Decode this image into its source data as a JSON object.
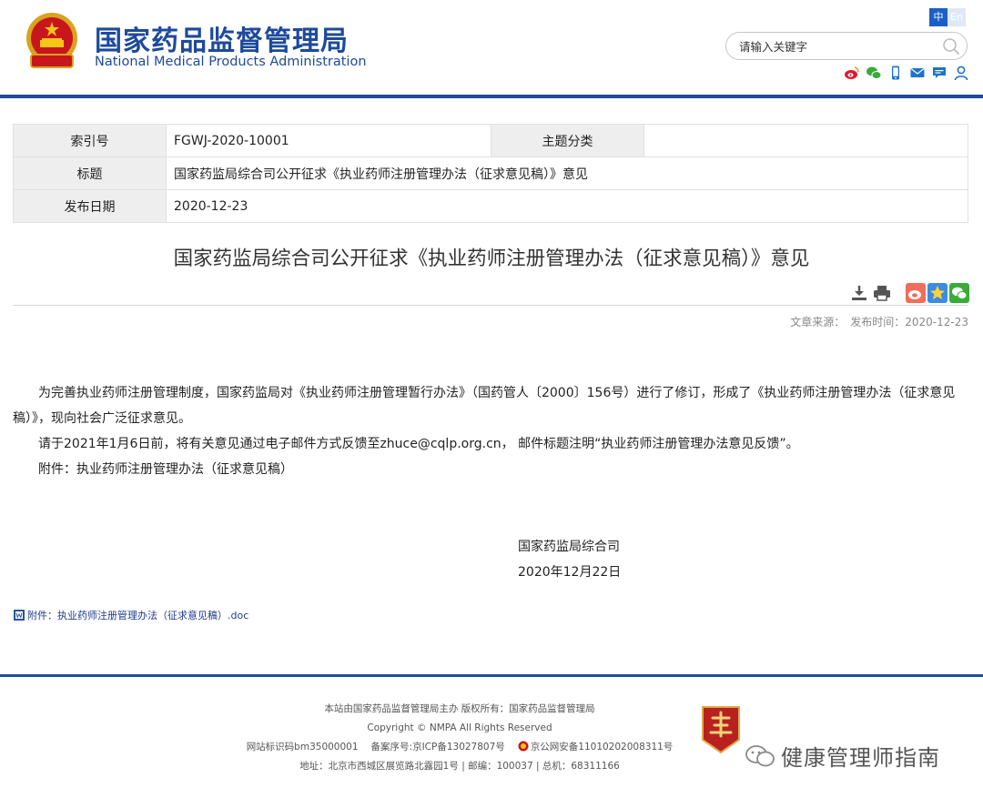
{
  "header": {
    "site_name_cn": "国家药品监督管理局",
    "site_name_en": "National Medical Products Administration",
    "lang_cn": "中",
    "lang_en": "En",
    "search_placeholder": "请输入关键字",
    "social_icons": [
      "weibo-icon",
      "wechat-icon",
      "mobile-icon",
      "mail-icon",
      "comment-icon",
      "user-icon"
    ]
  },
  "meta": {
    "index_label": "索引号",
    "index_value": "FGWJ-2020-10001",
    "topic_label": "主题分类",
    "topic_value": "",
    "title_label": "标题",
    "title_value": "国家药监局综合司公开征求《执业药师注册管理办法（征求意见稿）》意见",
    "date_label": "发布日期",
    "date_value": "2020-12-23"
  },
  "article": {
    "title": "国家药监局综合司公开征求《执业药师注册管理办法（征求意见稿）》意见",
    "source_label": "文章来源：",
    "time_label": "发布时间：2020-12-23",
    "paragraphs": [
      "为完善执业药师注册管理制度，国家药监局对《执业药师注册管理暂行办法》（国药管人〔2000〕156号）进行了修订，形成了《执业药师注册管理办法（征求意见稿）》，现向社会广泛征求意见。",
      "请于2021年1月6日前，将有关意见通过电子邮件方式反馈至zhuce@cqlp.org.cn， 邮件标题注明“执业药师注册管理办法意见反馈”。",
      "附件：执业药师注册管理办法（征求意见稿）"
    ],
    "signature_org": "国家药监局综合司",
    "signature_date": "2020年12月22日",
    "attachment_link": "附件：执业药师注册管理办法（征求意见稿）.doc"
  },
  "footer": {
    "line1": "本站由国家药品监督管理局主办 版权所有：国家药品监督管理局",
    "line2": "Copyright © NMPA All Rights Reserved",
    "line3_site_id": "网站标识码bm35000001",
    "line3_icp": "备案序号:京ICP备13027807号",
    "line3_police": "京公网安备11010202008311号",
    "line4": "地址：北京市西城区展览路北露园1号 | 邮编：100037 | 总机：68311166",
    "watermark": "健康管理师指南"
  },
  "colors": {
    "brand_blue": "#1d4a9c",
    "link_blue": "#1f3c88",
    "table_label_bg": "#eeeeee"
  }
}
